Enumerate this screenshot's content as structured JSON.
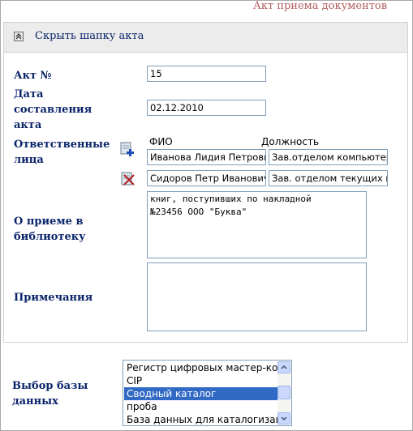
{
  "page": {
    "title": "Акт приема документов"
  },
  "header": {
    "toggle_label": "Скрыть шапку акта",
    "toggle_icon": "collapse-up-icon"
  },
  "form": {
    "act_number": {
      "label": "Акт №",
      "value": "15"
    },
    "act_date": {
      "label_lines": [
        "Дата",
        "составления",
        "акта"
      ],
      "value": "02.12.2010"
    },
    "responsible": {
      "label_lines": [
        "Ответственные",
        "лица"
      ],
      "col_fio": "ФИО",
      "col_position": "Должность",
      "add_icon": "add-person-icon",
      "remove_icon": "remove-person-icon",
      "rows": [
        {
          "fio": "Иванова Лидия Петровна",
          "position": "Зав.отделом компьютеризации"
        },
        {
          "fio": "Сидоров Петр Иванович",
          "position": "Зав. отделом текущих изданий"
        }
      ]
    },
    "acceptance": {
      "label_lines": [
        "О приеме в",
        "библиотеку"
      ],
      "text_lines": [
        "книг, поступивших по накладной",
        "№23456 ООО \"Буква\""
      ]
    },
    "notes": {
      "label": "Примечания",
      "value": ""
    }
  },
  "database": {
    "label_lines": [
      "Выбор базы",
      "данных"
    ],
    "options": [
      "Регистр цифровых мастер-копий",
      "CIP",
      "Сводный каталог",
      "проба",
      "База данных для каталогизации"
    ],
    "selected": "Сводный каталог"
  },
  "colors": {
    "label_color": "#0a246a",
    "title_color": "#b35c5c",
    "selection_color": "#316ac5",
    "border_color": "#7f9db9"
  }
}
